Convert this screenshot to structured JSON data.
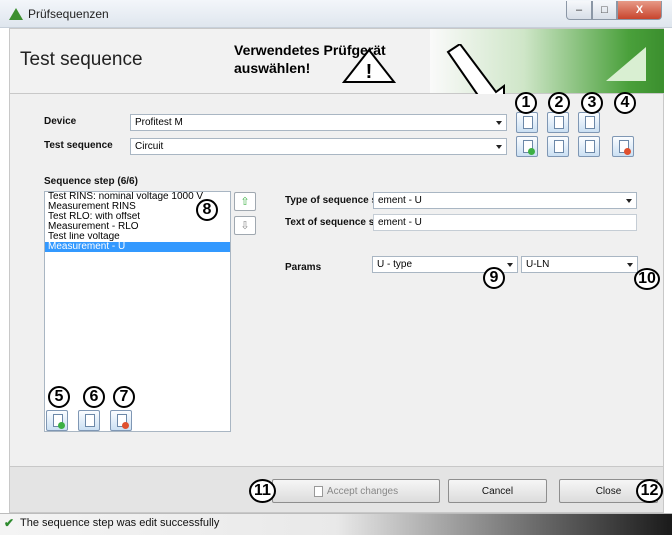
{
  "window": {
    "title": "Prüfsequenzen"
  },
  "header": {
    "title": "Test sequence",
    "callout_line1": "Verwendetes Prüfgerät",
    "callout_line2": "auswählen!",
    "warning_glyph": "!"
  },
  "device": {
    "label": "Device",
    "value": "Profitest M"
  },
  "test_sequence": {
    "label": "Test sequence",
    "value": "Circuit"
  },
  "sequence_step": {
    "label": "Sequence step (6/6)",
    "items": [
      "Test RINS: nominal voltage 1000 V",
      "Measurement RINS",
      "Test RLO: with offset",
      "Measurement - RLO",
      "Test line voltage",
      "Measurement - U"
    ],
    "selected_index": 5
  },
  "step_type": {
    "label": "Type of sequence step",
    "value": "ement - U"
  },
  "step_text": {
    "label": "Text of sequence step",
    "value": "ement - U"
  },
  "params": {
    "label": "Params",
    "param1": "U - type",
    "param2": "U-LN"
  },
  "markers": [
    "1",
    "2",
    "3",
    "4",
    "5",
    "6",
    "7",
    "8",
    "9",
    "10",
    "11",
    "12"
  ],
  "buttons": {
    "accept": "Accept changes",
    "cancel": "Cancel",
    "close": "Close",
    "move_up": "⇧",
    "move_down": "⇩"
  },
  "status": {
    "text": "The sequence step was edit successfully"
  },
  "colors": {
    "accent_green": "#3b8f2e",
    "selection_blue": "#3399ff"
  }
}
